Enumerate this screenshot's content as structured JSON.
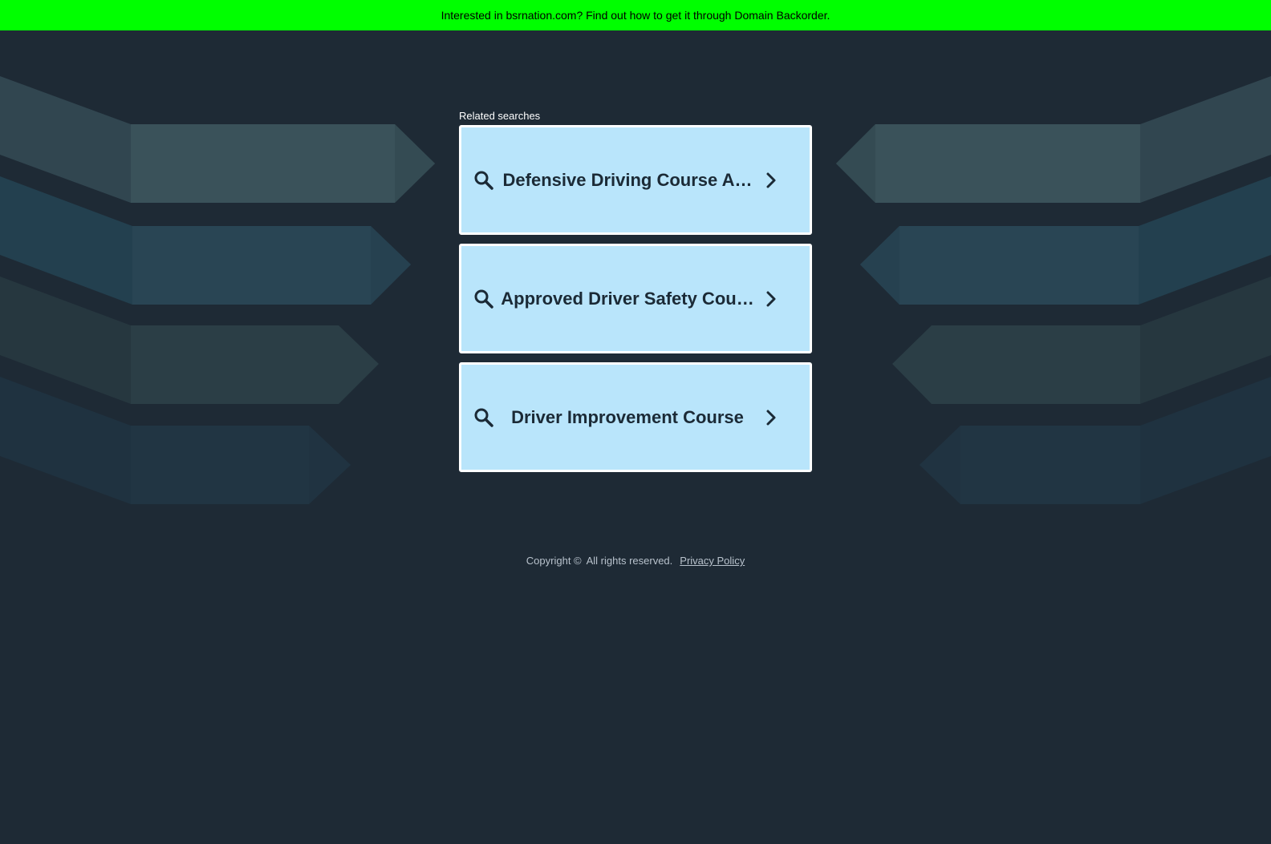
{
  "topbar": {
    "text": "Interested in bsrnation.com? Find out how to get it through Domain Backorder."
  },
  "related": {
    "label": "Related searches",
    "items": [
      {
        "label": "Defensive Driving Course A…"
      },
      {
        "label": "Approved Driver Safety Cou…"
      },
      {
        "label": "Driver Improvement Course"
      }
    ]
  },
  "footer": {
    "copyright": "Copyright ©",
    "rights": "All rights reserved.",
    "privacy": "Privacy Policy"
  },
  "colors": {
    "topbar": "#00ff00",
    "background": "#1e2a35",
    "card": "#b9e5fb",
    "card_text": "#1b2a36"
  },
  "icons": {
    "search": "search-icon",
    "chevron": "chevron-right-icon"
  }
}
